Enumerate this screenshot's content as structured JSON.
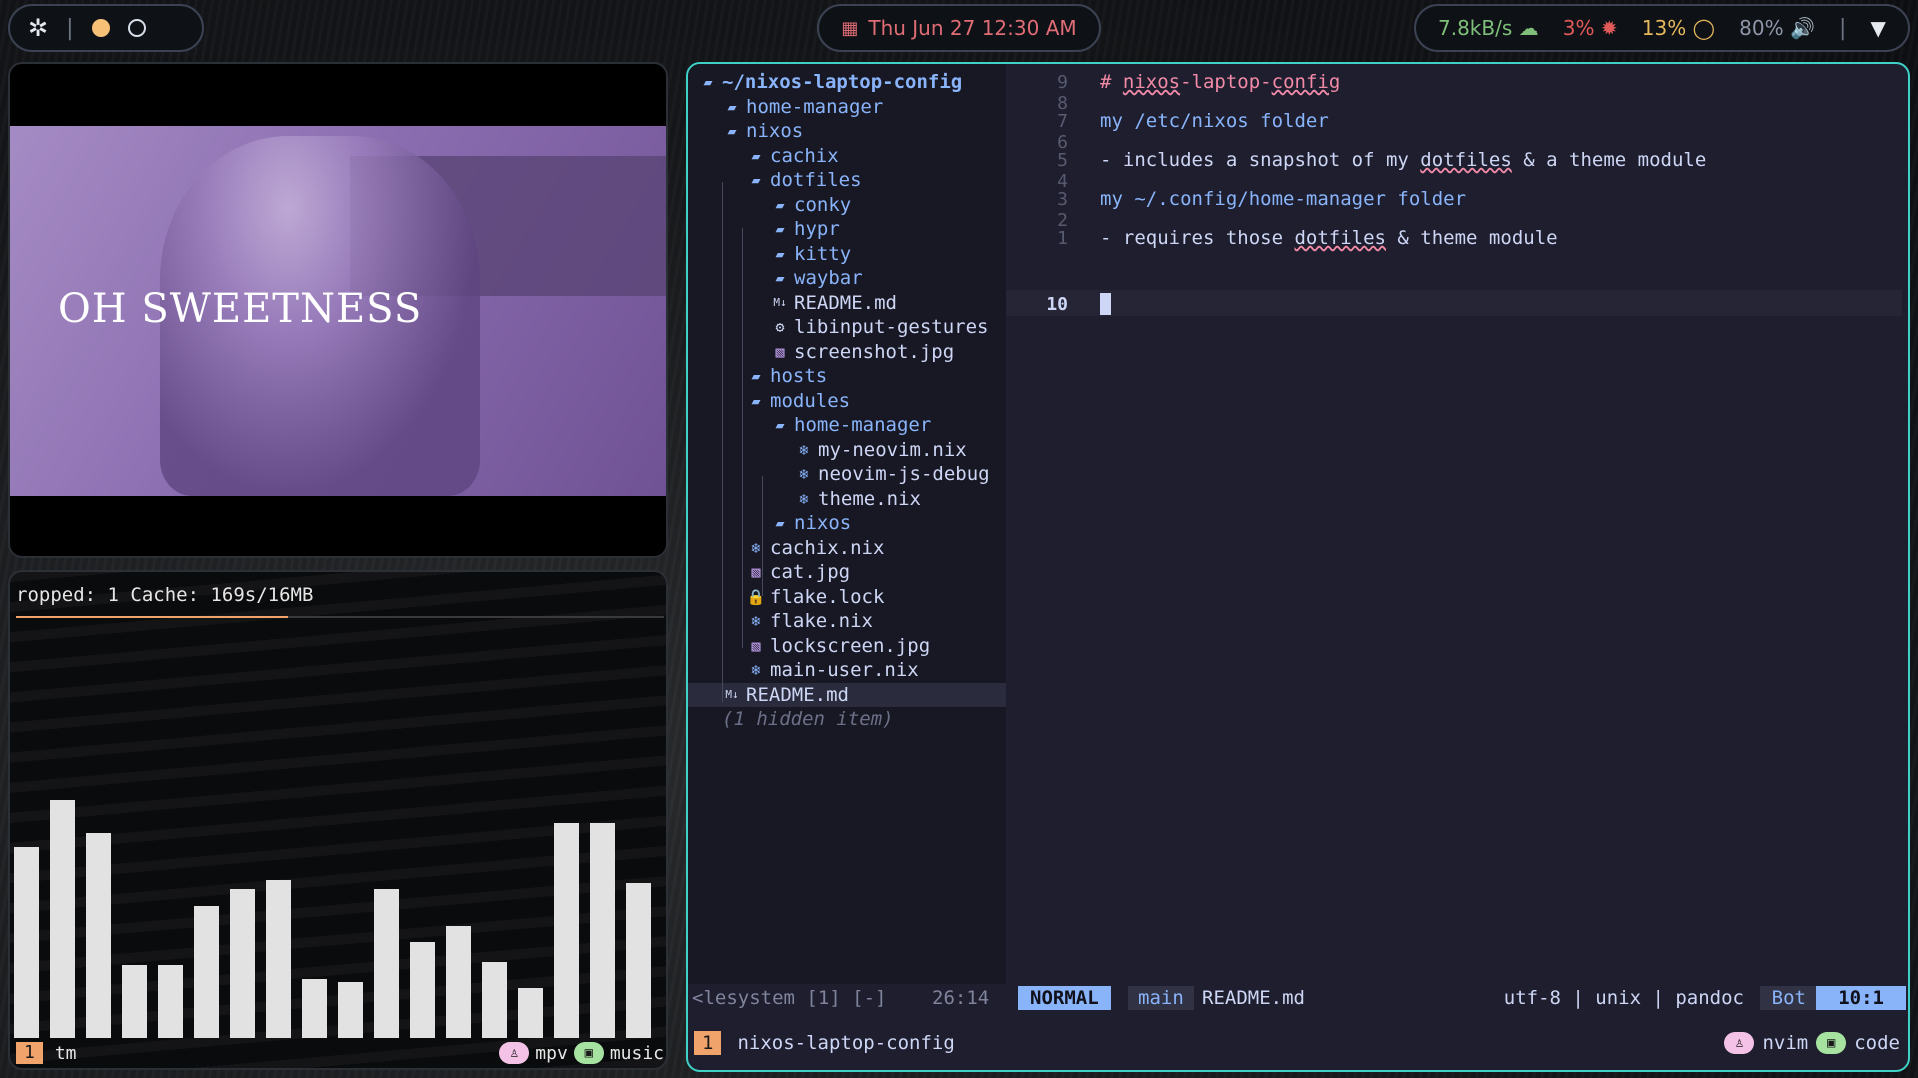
{
  "topbar": {
    "left_icon": "gear-icon",
    "separator": "|",
    "clock_icon": "calendar-icon",
    "clock": "Thu Jun 27   12:30 AM",
    "net": "7.8kB/s",
    "cpu": "3%",
    "mem": "13%",
    "volume": "80%",
    "sep2": "|"
  },
  "video": {
    "overlay_title": "OH SWEETNESS"
  },
  "music": {
    "cache_line": "ropped: 1 Cache: 169s/16MB",
    "progress": 0.42,
    "bars": [
      0.58,
      0.72,
      0.62,
      0.22,
      0.22,
      0.4,
      0.45,
      0.48,
      0.18,
      0.17,
      0.45,
      0.29,
      0.34,
      0.23,
      0.15,
      0.65,
      0.65,
      0.47
    ],
    "tmux": {
      "window_num": "1",
      "session": "tm",
      "app1": "mpv",
      "app2": "music"
    }
  },
  "tree": {
    "root": "~/nixos-laptop-config",
    "items": [
      {
        "label": "home-manager",
        "kind": "dir"
      },
      {
        "label": "nixos",
        "kind": "dir-open"
      },
      {
        "label": "cachix",
        "kind": "dir"
      },
      {
        "label": "dotfiles",
        "kind": "dir-open"
      },
      {
        "label": "conky",
        "kind": "dir"
      },
      {
        "label": "hypr",
        "kind": "dir"
      },
      {
        "label": "kitty",
        "kind": "dir"
      },
      {
        "label": "waybar",
        "kind": "dir"
      },
      {
        "label": "README.md",
        "kind": "md"
      },
      {
        "label": "libinput-gestures",
        "kind": "conf"
      },
      {
        "label": "screenshot.jpg",
        "kind": "img"
      },
      {
        "label": "hosts",
        "kind": "dir"
      },
      {
        "label": "modules",
        "kind": "dir-open"
      },
      {
        "label": "home-manager",
        "kind": "dir-open"
      },
      {
        "label": "my-neovim.nix",
        "kind": "nix"
      },
      {
        "label": "neovim-js-debug",
        "kind": "nix"
      },
      {
        "label": "theme.nix",
        "kind": "nix"
      },
      {
        "label": "nixos",
        "kind": "dir"
      },
      {
        "label": "cachix.nix",
        "kind": "nix"
      },
      {
        "label": "cat.jpg",
        "kind": "img"
      },
      {
        "label": "flake.lock",
        "kind": "lock"
      },
      {
        "label": "flake.nix",
        "kind": "nix"
      },
      {
        "label": "lockscreen.jpg",
        "kind": "img"
      },
      {
        "label": "main-user.nix",
        "kind": "nix"
      },
      {
        "label": "README.md",
        "kind": "md"
      },
      {
        "label": "(1 hidden item)",
        "kind": "hidden"
      }
    ]
  },
  "editor": {
    "line_numbers": [
      "9",
      "8",
      "7",
      "6",
      "5",
      "4",
      "3",
      "2",
      "1",
      "10"
    ],
    "heading_hash": "#",
    "heading_a": "nixos",
    "heading_b": "-laptop-",
    "heading_c": "config",
    "line3": "my /etc/nixos folder",
    "line5_a": "- includes a snapshot of my ",
    "line5_b": "dotfiles",
    "line5_c": " & a theme module",
    "line7": "my ~/.config/home-manager folder",
    "line9_a": "- requires those ",
    "line9_b": "dotfiles",
    "line9_c": " & theme module"
  },
  "statusline": {
    "tree_name": "<lesystem [1] [-]",
    "tree_pos": "26:14",
    "mode": "NORMAL",
    "branch": "main",
    "file": "README.md",
    "encoding": "utf-8 | unix | pandoc",
    "percent": "Bot",
    "location": "10:1"
  },
  "tmux_editor": {
    "window_num": "1",
    "session": "nixos-laptop-config",
    "app1": "nvim",
    "app2": "code"
  }
}
